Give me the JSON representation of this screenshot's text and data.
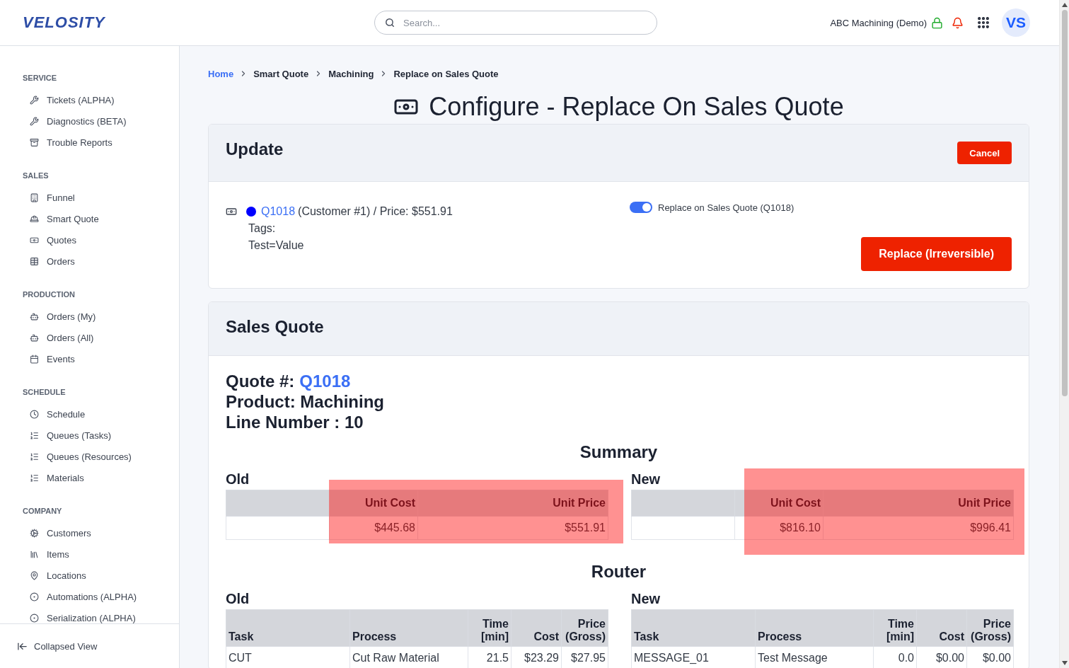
{
  "header": {
    "logo": "VELOSITY",
    "search": {
      "placeholder": "Search..."
    },
    "account": "ABC Machining (Demo)",
    "avatar": "VS"
  },
  "sidebar": {
    "sections": [
      {
        "title": "SERVICE",
        "items": [
          {
            "label": "Tickets (ALPHA)"
          },
          {
            "label": "Diagnostics (BETA)"
          },
          {
            "label": "Trouble Reports"
          }
        ]
      },
      {
        "title": "SALES",
        "items": [
          {
            "label": "Funnel"
          },
          {
            "label": "Smart Quote"
          },
          {
            "label": "Quotes"
          },
          {
            "label": "Orders"
          }
        ]
      },
      {
        "title": "PRODUCTION",
        "items": [
          {
            "label": "Orders (My)"
          },
          {
            "label": "Orders (All)"
          },
          {
            "label": "Events"
          }
        ]
      },
      {
        "title": "SCHEDULE",
        "items": [
          {
            "label": "Schedule"
          },
          {
            "label": "Queues (Tasks)"
          },
          {
            "label": "Queues (Resources)"
          },
          {
            "label": "Materials"
          }
        ]
      },
      {
        "title": "COMPANY",
        "items": [
          {
            "label": "Customers"
          },
          {
            "label": "Items"
          },
          {
            "label": "Locations"
          },
          {
            "label": "Automations (ALPHA)"
          },
          {
            "label": "Serialization (ALPHA)"
          }
        ]
      }
    ],
    "footer": "Collapsed View"
  },
  "breadcrumb": [
    {
      "label": "Home",
      "link": true
    },
    {
      "label": "Smart Quote",
      "link": false
    },
    {
      "label": "Machining",
      "link": false
    },
    {
      "label": "Replace on Sales Quote",
      "link": false
    }
  ],
  "page_title": "Configure - Replace On Sales Quote",
  "update_card": {
    "title": "Update",
    "cancel_button": "Cancel",
    "quote": {
      "number": "Q1018",
      "details": "(Customer #1) / Price: $551.91",
      "tags_label": "Tags:",
      "tags": [
        "Test=Value"
      ]
    },
    "toggle": {
      "label": "Replace on Sales Quote (Q1018)",
      "on": true
    },
    "replace_button": "Replace (Irreversible)"
  },
  "sales_quote": {
    "title": "Sales Quote",
    "quote_label": "Quote #:",
    "quote_number": "Q1018",
    "product": "Product: Machining",
    "line_number": "Line Number : 10",
    "summary": {
      "title": "Summary",
      "tables": [
        {
          "label": "Old",
          "highlighted": true,
          "columns": [
            "Unit Cost",
            "Unit Price"
          ],
          "rows": [
            [
              "$445.68",
              "$551.91"
            ]
          ]
        },
        {
          "label": "New",
          "highlighted": true,
          "columns": [
            "Unit Cost",
            "Unit Price"
          ],
          "rows": [
            [
              "$816.10",
              "$996.41"
            ]
          ]
        }
      ]
    },
    "router": {
      "title": "Router",
      "tables": [
        {
          "label": "Old",
          "columns": [
            "Task",
            "Process",
            "Time [min]",
            "Cost",
            "Price (Gross)"
          ],
          "rows": [
            [
              "CUT",
              "Cut Raw Material",
              "21.5",
              "$23.29",
              "$27.95"
            ]
          ]
        },
        {
          "label": "New",
          "columns": [
            "Task",
            "Process",
            "Time [min]",
            "Cost",
            "Price (Gross)"
          ],
          "rows": [
            [
              "MESSAGE_01",
              "Test Message",
              "0.0",
              "$0.00",
              "$0.00"
            ]
          ]
        }
      ]
    }
  }
}
